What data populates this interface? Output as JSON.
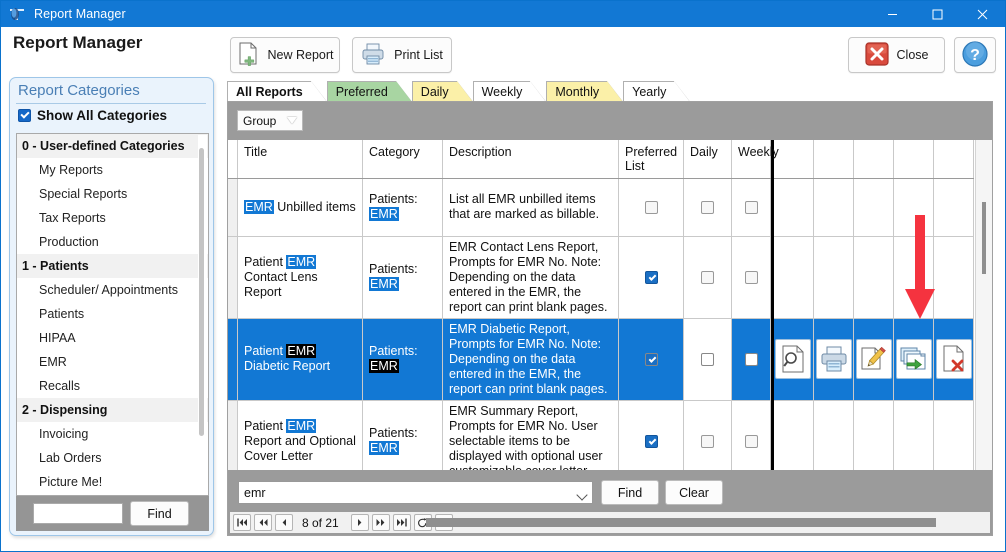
{
  "window": {
    "title": "Report Manager",
    "app_icon": "app-logo-icon",
    "minimize": "minimize-icon",
    "maximize": "maximize-icon",
    "close": "close-icon"
  },
  "header": {
    "title": "Report Manager",
    "buttons": [
      {
        "label": "New Report",
        "icon": "new-document-icon"
      },
      {
        "label": "Print List",
        "icon": "printer-icon"
      },
      {
        "label": "Close",
        "icon": "red-close-icon"
      },
      {
        "label": "",
        "icon": "help-question-icon"
      }
    ]
  },
  "sidebar": {
    "title": "Report Categories",
    "show_all_label": "Show All Categories",
    "show_all_checked": true,
    "categories": [
      {
        "type": "group",
        "label": "0 - User-defined Categories"
      },
      {
        "type": "item",
        "label": "My Reports"
      },
      {
        "type": "item",
        "label": "Special Reports"
      },
      {
        "type": "item",
        "label": "Tax Reports"
      },
      {
        "type": "item",
        "label": "Production"
      },
      {
        "type": "group",
        "label": "1 - Patients"
      },
      {
        "type": "item",
        "label": "Scheduler/ Appointments"
      },
      {
        "type": "item",
        "label": "Patients"
      },
      {
        "type": "item",
        "label": "HIPAA"
      },
      {
        "type": "item",
        "label": "EMR"
      },
      {
        "type": "item",
        "label": "Recalls"
      },
      {
        "type": "group",
        "label": "2 - Dispensing"
      },
      {
        "type": "item",
        "label": "Invoicing"
      },
      {
        "type": "item",
        "label": "Lab Orders"
      },
      {
        "type": "item",
        "label": "Picture Me!"
      }
    ],
    "find_value": "",
    "find_button": "Find"
  },
  "tabs": [
    {
      "label": "All Reports",
      "color": "#ffffff",
      "active": true
    },
    {
      "label": "Preferred",
      "color": "#a8d5a2",
      "active": false
    },
    {
      "label": "Daily",
      "color": "#fbf0a8",
      "active": false
    },
    {
      "label": "Weekly",
      "color": "#ffffff",
      "active": false
    },
    {
      "label": "Monthly",
      "color": "#fbf0a8",
      "active": false
    },
    {
      "label": "Yearly",
      "color": "#ffffff",
      "active": false
    }
  ],
  "grid": {
    "group_label": "Group",
    "columns": [
      "Title",
      "Category",
      "Description",
      "Preferred List",
      "Daily",
      "Weekly"
    ],
    "rows": [
      {
        "title_pre": "",
        "title_hl": "EMR",
        "title_post": " Unbilled items",
        "category_pre": "Patients: ",
        "category_hl": "EMR",
        "description": "List all EMR unbilled items that are marked as billable.",
        "preferred": false,
        "daily": false,
        "weekly": false,
        "selected": false,
        "show_actions": false
      },
      {
        "title_pre": "Patient ",
        "title_hl": "EMR",
        "title_post": " Contact Lens Report",
        "category_pre": "Patients: ",
        "category_hl": "EMR",
        "description": "EMR Contact Lens Report, Prompts for EMR No.  Note: Depending on the data entered in the EMR, the report can print blank pages.",
        "preferred": true,
        "daily": false,
        "weekly": false,
        "selected": false,
        "show_actions": false
      },
      {
        "title_pre": "Patient ",
        "title_hl": "EMR",
        "title_post": " Diabetic Report",
        "category_pre": "Patients: ",
        "category_hl": "EMR",
        "description": "EMR Diabetic Report, Prompts for EMR No.  Note: Depending on the data entered in the EMR, the report can print blank pages.",
        "preferred": true,
        "daily": false,
        "weekly": false,
        "selected": true,
        "show_actions": true
      },
      {
        "title_pre": "Patient ",
        "title_hl": "EMR",
        "title_post": " Report and Optional Cover Letter",
        "category_pre": "Patients: ",
        "category_hl": "EMR",
        "description": "EMR Summary Report, Prompts for EMR No.  User selectable items to be displayed with optional user customizable cover letter",
        "preferred": true,
        "daily": false,
        "weekly": false,
        "selected": false,
        "show_actions": false
      },
      {
        "title_pre": "",
        "title_hl": "",
        "title_post": "",
        "category_pre": "",
        "category_hl": "",
        "description": "EMR Summary Report, Prompts for EMR No.  User selectable items to",
        "preferred": null,
        "daily": null,
        "weekly": null,
        "selected": false,
        "show_actions": false
      }
    ],
    "row_actions": [
      {
        "name": "preview-icon",
        "title": "Preview"
      },
      {
        "name": "print-icon",
        "title": "Print"
      },
      {
        "name": "edit-icon",
        "title": "Edit"
      },
      {
        "name": "copy-icon",
        "title": "Copy"
      },
      {
        "name": "delete-icon",
        "title": "Delete"
      }
    ],
    "search_value": "emr",
    "find_button": "Find",
    "clear_button": "Clear",
    "pager": {
      "first": "⏮",
      "prev_page": "◀◀",
      "prev": "◀",
      "position": "8 of 21",
      "next": "▶",
      "next_page": "▶▶",
      "last": "⏭",
      "refresh": "↻",
      "filter": "filter-icon"
    }
  },
  "annotation": {
    "arrow": "red-down-arrow",
    "color": "#f5333f"
  }
}
